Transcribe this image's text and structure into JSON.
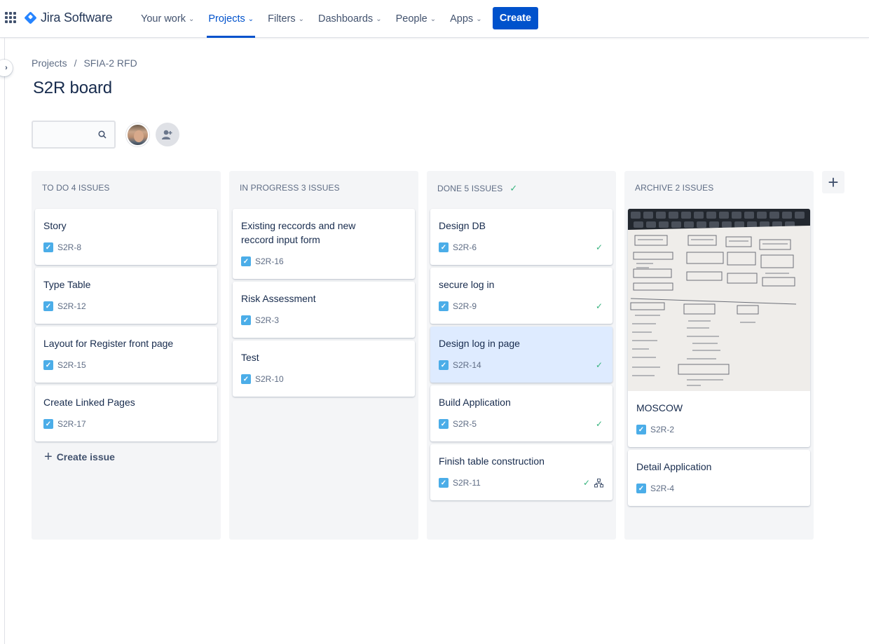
{
  "nav": {
    "product_name": "Jira Software",
    "items": [
      {
        "label": "Your work",
        "active": false
      },
      {
        "label": "Projects",
        "active": true
      },
      {
        "label": "Filters",
        "active": false
      },
      {
        "label": "Dashboards",
        "active": false
      },
      {
        "label": "People",
        "active": false
      },
      {
        "label": "Apps",
        "active": false
      }
    ],
    "create_label": "Create",
    "accent_color": "#0052CC"
  },
  "breadcrumb": [
    "Projects",
    "SFIA-2 RFD"
  ],
  "page_title": "S2R board",
  "search": {
    "value": "",
    "placeholder": ""
  },
  "board": {
    "columns": [
      {
        "title": "TO DO 4 ISSUES",
        "done": false,
        "cards": [
          {
            "title": "Story",
            "key": "S2R-8"
          },
          {
            "title": "Type Table",
            "key": "S2R-12"
          },
          {
            "title": "Layout for Register front page",
            "key": "S2R-15"
          },
          {
            "title": "Create Linked Pages",
            "key": "S2R-17"
          }
        ],
        "create_label": "Create issue"
      },
      {
        "title": "IN PROGRESS 3 ISSUES",
        "done": false,
        "cards": [
          {
            "title": "Existing reccords and new reccord input form",
            "key": "S2R-16"
          },
          {
            "title": "Risk Assessment",
            "key": "S2R-3"
          },
          {
            "title": "Test",
            "key": "S2R-10"
          }
        ]
      },
      {
        "title": "DONE 5 ISSUES",
        "done": true,
        "cards": [
          {
            "title": "Design DB",
            "key": "S2R-6",
            "done": true
          },
          {
            "title": "secure log in",
            "key": "S2R-9",
            "done": true
          },
          {
            "title": "Design log in page",
            "key": "S2R-14",
            "done": true,
            "selected": true
          },
          {
            "title": "Build Application",
            "key": "S2R-5",
            "done": true
          },
          {
            "title": "Finish table construction",
            "key": "S2R-11",
            "done": true,
            "has_children": true
          }
        ]
      },
      {
        "title": "ARCHIVE 2 ISSUES",
        "done": false,
        "cards": [
          {
            "title": "MOSCOW",
            "key": "S2R-2",
            "has_cover_image": true
          },
          {
            "title": "Detail Application",
            "key": "S2R-4"
          }
        ]
      }
    ]
  },
  "colors": {
    "story": "#4BADE8",
    "done": "#36B37E",
    "column_bg": "#F4F5F7",
    "selected_card": "#DEEBFF"
  }
}
